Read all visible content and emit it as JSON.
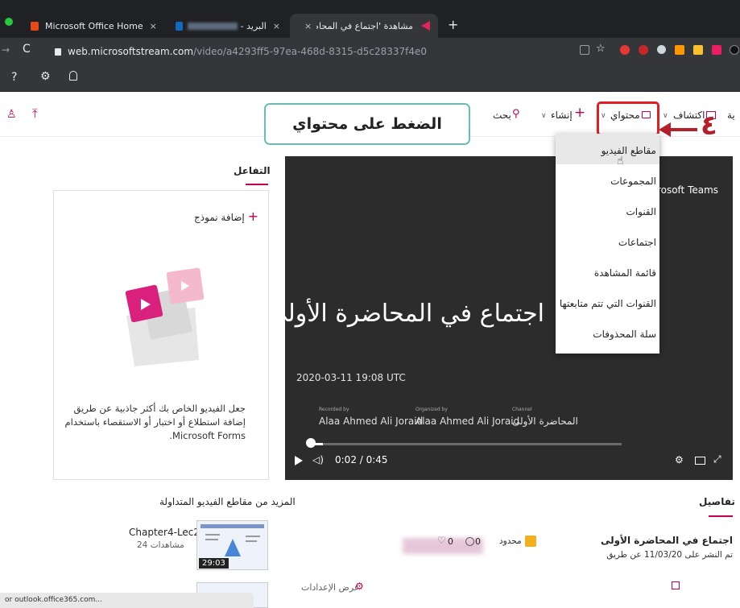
{
  "browser": {
    "tabs": [
      {
        "label": "Microsoft Office Home",
        "active": false
      },
      {
        "label": "- البريد",
        "active": false
      },
      {
        "label": "مشاهدة 'اجتماع في المحاضرة الأولى",
        "active": true
      }
    ],
    "url_main": "web.microsoftstream.com",
    "url_rest": "/video/a4293ff5-97ea-468d-8315-d5c28337f4e0",
    "status_text": "or outlook.office365.com..."
  },
  "nav": {
    "discover": "اكتشاف",
    "content": "محتواي",
    "create": "إنشاء",
    "search": "بحث",
    "home_fragment": "ية"
  },
  "callout": {
    "text": "الضغط على محتواي",
    "step": "٤"
  },
  "dropdown": {
    "items": [
      "مقاطع الفيديو",
      "المجموعات",
      "القنوات",
      "اجتماعات",
      "قائمة المشاهدة",
      "القنوات التي تتم متابعتها",
      "سلة المحذوفات"
    ]
  },
  "interaction": {
    "title": "التفاعل",
    "add_form": "إضافة نموذج",
    "description": "جعل الفيديو الخاص بك أكثر جاذبية عن طريق إضافة استطلاع أو اختبار أو الاستقصاء باستخدام Microsoft Forms."
  },
  "video": {
    "title": "اجتماع في المحاضرة الأولى",
    "date": "2020-03-11 19:08 UTC",
    "recorded_by_label": "Recorded by",
    "recorded_by": "Alaa Ahmed Ali Joraid",
    "organized_by_label": "Organized by",
    "organized_by": "Alaa Ahmed Ali Joraid",
    "channel_label": "Channel",
    "channel": "المحاضرة الأولى",
    "source_fragment": "icrosoft Teams",
    "time": "0:02 / 0:45",
    "progress": 0.044
  },
  "trending": {
    "title": "المزيد من مقاطع الفيديو المتداولة",
    "items": [
      {
        "title": "Chapter4-Lec2",
        "views": "24 مشاهدات",
        "duration": "29:03"
      }
    ]
  },
  "details": {
    "title": "تفاصيل",
    "video_name": "اجتماع في المحاضرة الأولى",
    "published": "تم النشر على 11/03/20 عن طريق",
    "privacy": "محدود",
    "likes": "0",
    "views": "0",
    "settings_label": "عرض الإعدادات"
  }
}
